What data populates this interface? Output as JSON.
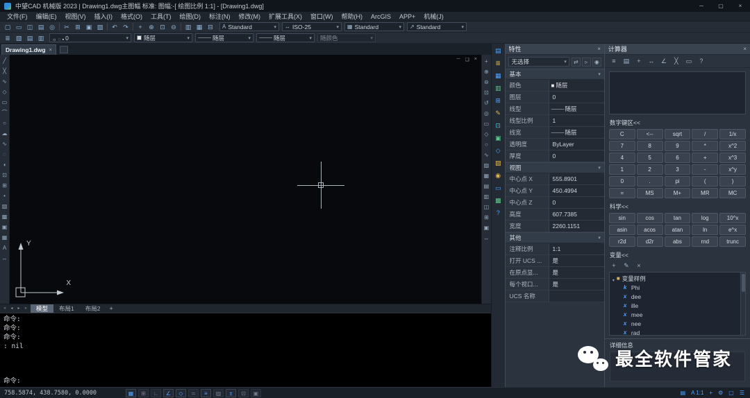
{
  "window": {
    "title": "中望CAD 机械版 2023 | Drawing1.dwg主图幅 标准: 图幅:-[ 绘图比例 1:1] - [Drawing1.dwg]",
    "minimize": "─",
    "maximize": "▢",
    "close": "×"
  },
  "menu": {
    "items": [
      "文件(F)",
      "编辑(E)",
      "视图(V)",
      "插入(I)",
      "格式(O)",
      "工具(T)",
      "绘图(D)",
      "标注(N)",
      "修改(M)",
      "扩展工具(X)",
      "窗口(W)",
      "帮助(H)",
      "ArcGIS",
      "APP+",
      "机械(J)"
    ]
  },
  "toolbar1": {
    "icons": [
      {
        "name": "new-file-icon",
        "glyph": "▢"
      },
      {
        "name": "open-file-icon",
        "glyph": "▭"
      },
      {
        "name": "save-icon",
        "glyph": "◫"
      },
      {
        "name": "plot-icon",
        "glyph": "▤"
      },
      {
        "name": "preview-icon",
        "glyph": "◎"
      },
      {
        "name": "separator",
        "glyph": "",
        "cls": "sep"
      },
      {
        "name": "cut-icon",
        "glyph": "✂"
      },
      {
        "name": "copy-icon",
        "glyph": "⊞"
      },
      {
        "name": "paste-icon",
        "glyph": "▣"
      },
      {
        "name": "match-properties-icon",
        "glyph": "▨"
      },
      {
        "name": "separator",
        "glyph": "",
        "cls": "sep"
      },
      {
        "name": "undo-icon",
        "glyph": "↶"
      },
      {
        "name": "redo-icon",
        "glyph": "↷"
      },
      {
        "name": "separator",
        "glyph": "",
        "cls": "sep"
      },
      {
        "name": "pan-icon",
        "glyph": "+"
      },
      {
        "name": "zoom-realtime-icon",
        "glyph": "⊕"
      },
      {
        "name": "zoom-window-icon",
        "glyph": "⊡"
      },
      {
        "name": "zoom-previous-icon",
        "glyph": "⊖"
      },
      {
        "name": "separator",
        "glyph": "",
        "cls": "sep"
      },
      {
        "name": "properties-toggle-icon",
        "glyph": "▥"
      },
      {
        "name": "designcenter-toggle-icon",
        "glyph": "▦"
      },
      {
        "name": "quickcalc-toggle-icon",
        "glyph": "⊟"
      }
    ],
    "dropdowns": [
      {
        "name": "text-style-dropdown",
        "icon": "A",
        "value": "Standard"
      },
      {
        "name": "dim-style-dropdown",
        "icon": "↔",
        "value": "ISO-25"
      },
      {
        "name": "table-style-dropdown",
        "icon": "▦",
        "value": "Standard"
      },
      {
        "name": "mleader-style-dropdown",
        "icon": "↗",
        "value": "Standard"
      }
    ]
  },
  "toolbar2": {
    "icons": [
      {
        "name": "layer-properties-icon",
        "glyph": "≣"
      },
      {
        "name": "layer-states-icon",
        "glyph": "▧"
      },
      {
        "name": "layer-isolate-icon",
        "glyph": "▤"
      },
      {
        "name": "layer-previous-icon",
        "glyph": "▥"
      }
    ],
    "layer": {
      "state_icons": [
        "☼",
        "◌",
        "▪"
      ],
      "value": "0"
    },
    "color": {
      "value": "随层"
    },
    "linetype": {
      "prefix": "———",
      "value": "随层"
    },
    "lineweight": {
      "prefix": "———",
      "value": "随层"
    },
    "plotstyle": {
      "value": "随颜色"
    }
  },
  "doc_tab": {
    "label": "Drawing1.dwg",
    "close": "×"
  },
  "canvas_controls": {
    "min": "─",
    "restore": "❏",
    "close": "×"
  },
  "ucs": {
    "x": "X",
    "y": "Y"
  },
  "draw_tools": {
    "icons": [
      {
        "name": "line-tool-icon",
        "glyph": "╱"
      },
      {
        "name": "xline-tool-icon",
        "glyph": "╳"
      },
      {
        "name": "polyline-tool-icon",
        "glyph": "∿"
      },
      {
        "name": "polygon-tool-icon",
        "glyph": "◇"
      },
      {
        "name": "rectangle-tool-icon",
        "glyph": "▭"
      },
      {
        "name": "arc-tool-icon",
        "glyph": "⌒"
      },
      {
        "name": "circle-tool-icon",
        "glyph": "○"
      },
      {
        "name": "revcloud-tool-icon",
        "glyph": "☁"
      },
      {
        "name": "spline-tool-icon",
        "glyph": "∿"
      },
      {
        "name": "ellipse-tool-icon",
        "glyph": "◌"
      },
      {
        "name": "ellipse-arc-tool-icon",
        "glyph": "◖"
      },
      {
        "name": "insert-block-tool-icon",
        "glyph": "⊡"
      },
      {
        "name": "make-block-tool-icon",
        "glyph": "⊞"
      },
      {
        "name": "point-tool-icon",
        "glyph": "•"
      },
      {
        "name": "hatch-tool-icon",
        "glyph": "▨"
      },
      {
        "name": "gradient-tool-icon",
        "glyph": "▩"
      },
      {
        "name": "region-tool-icon",
        "glyph": "▣"
      },
      {
        "name": "table-tool-icon",
        "glyph": "▦"
      },
      {
        "name": "text-tool-icon",
        "glyph": "A"
      },
      {
        "name": "dimension-tool-icon",
        "glyph": "↔"
      }
    ]
  },
  "view_tools": {
    "icons": [
      {
        "name": "pan-tool-icon",
        "glyph": "+"
      },
      {
        "name": "zoom-in-tool-icon",
        "glyph": "⊕"
      },
      {
        "name": "zoom-out-tool-icon",
        "glyph": "⊖"
      },
      {
        "name": "zoom-window-tool-icon",
        "glyph": "⊡"
      },
      {
        "name": "zoom-previous-tool-icon",
        "glyph": "↺"
      },
      {
        "name": "zoom-extents-tool-icon",
        "glyph": "◎"
      },
      {
        "name": "named-views-tool-icon",
        "glyph": "▭"
      },
      {
        "name": "orbit-tool-icon",
        "glyph": "◇"
      },
      {
        "name": "circle-view-tool-icon",
        "glyph": "○"
      },
      {
        "name": "regen-tool-icon",
        "glyph": "∿"
      },
      {
        "name": "hatch-view-tool-icon",
        "glyph": "▨"
      },
      {
        "name": "grid-view-tool-icon",
        "glyph": "▦"
      },
      {
        "name": "layout-view-tool-icon",
        "glyph": "▤"
      },
      {
        "name": "sheet-view-tool-icon",
        "glyph": "▥"
      },
      {
        "name": "save-view-tool-icon",
        "glyph": "◫"
      },
      {
        "name": "block-view-tool-icon",
        "glyph": "⊞"
      },
      {
        "name": "region-view-tool-icon",
        "glyph": "▣"
      },
      {
        "name": "measure-tool-icon",
        "glyph": "↔"
      }
    ]
  },
  "panel_strip": {
    "icons": [
      {
        "name": "properties-panel-icon",
        "glyph": "▤",
        "cls": "c-blue"
      },
      {
        "name": "layers-panel-icon",
        "glyph": "≣",
        "cls": "c-yellow"
      },
      {
        "name": "designcenter-panel-icon",
        "glyph": "▦",
        "cls": "c-blue"
      },
      {
        "name": "toolpalette-panel-icon",
        "glyph": "▥",
        "cls": "c-green"
      },
      {
        "name": "calculator-panel-icon",
        "glyph": "⊞",
        "cls": "c-blue"
      },
      {
        "name": "markup-panel-icon",
        "glyph": "✎",
        "cls": "c-yellow"
      },
      {
        "name": "xref-panel-icon",
        "glyph": "⊡",
        "cls": "c-cyan"
      },
      {
        "name": "sheetset-panel-icon",
        "glyph": "▣",
        "cls": "c-green"
      },
      {
        "name": "visualstyle-panel-icon",
        "glyph": "◇",
        "cls": "c-blue"
      },
      {
        "name": "materials-panel-icon",
        "glyph": "▨",
        "cls": "c-yellow"
      },
      {
        "name": "lights-panel-icon",
        "glyph": "◉",
        "cls": "c-yellow"
      },
      {
        "name": "views-panel-icon",
        "glyph": "▭",
        "cls": "c-blue"
      },
      {
        "name": "render-panel-icon",
        "glyph": "▩",
        "cls": "c-green"
      },
      {
        "name": "help-panel-icon",
        "glyph": "?",
        "cls": "c-blue"
      }
    ]
  },
  "layout_tabs": {
    "nav": [
      "«",
      "◂",
      "▸",
      "»"
    ],
    "tabs": [
      {
        "label": "模型",
        "active": true
      },
      {
        "label": "布局1"
      },
      {
        "label": "布局2"
      }
    ],
    "add": "+"
  },
  "command": {
    "history": [
      "命令:",
      "命令:",
      "命令:",
      ": nil"
    ],
    "prompt": "命令:"
  },
  "properties": {
    "title": "特性",
    "close": "×",
    "selector": {
      "value": "无选择"
    },
    "selector_icons": [
      {
        "name": "toggle-pickadd-icon",
        "glyph": "⇄"
      },
      {
        "name": "select-objects-icon",
        "glyph": "▹"
      },
      {
        "name": "quick-select-icon",
        "glyph": "◉"
      }
    ],
    "groups": [
      {
        "name": "基本",
        "rows": [
          {
            "label": "颜色",
            "value": "随层",
            "pre": "■",
            "cls": "c-color"
          },
          {
            "label": "图层",
            "value": "0"
          },
          {
            "label": "线型",
            "value": "随层",
            "pre": "———"
          },
          {
            "label": "线型比例",
            "value": "1"
          },
          {
            "label": "线宽",
            "value": "随层",
            "pre": "———"
          },
          {
            "label": "透明度",
            "value": "ByLayer"
          },
          {
            "label": "厚度",
            "value": "0"
          }
        ]
      },
      {
        "name": "视图",
        "rows": [
          {
            "label": "中心点 X",
            "value": "555.8901"
          },
          {
            "label": "中心点 Y",
            "value": "450.4994"
          },
          {
            "label": "中心点 Z",
            "value": "0"
          },
          {
            "label": "高度",
            "value": "607.7385"
          },
          {
            "label": "宽度",
            "value": "2260.1151"
          }
        ]
      },
      {
        "name": "其他",
        "rows": [
          {
            "label": "注释比例",
            "value": "1:1"
          },
          {
            "label": "打开 UCS ...",
            "value": "是"
          },
          {
            "label": "在原点显...",
            "value": "是"
          },
          {
            "label": "每个视口...",
            "value": "是"
          },
          {
            "label": "UCS 名称",
            "value": ""
          }
        ]
      }
    ]
  },
  "calculator": {
    "title": "计算器",
    "close": "×",
    "toolbar": [
      {
        "name": "calc-more-icon",
        "glyph": "≡"
      },
      {
        "name": "calc-store-icon",
        "glyph": "▤"
      },
      {
        "name": "calc-get-coordinate-icon",
        "glyph": "+"
      },
      {
        "name": "calc-distance-icon",
        "glyph": "↔"
      },
      {
        "name": "calc-angle-icon",
        "glyph": "∠"
      },
      {
        "name": "calc-intersection-icon",
        "glyph": "╳"
      },
      {
        "name": "calc-clear-icon",
        "glyph": "▭"
      },
      {
        "name": "calc-help-icon",
        "glyph": "?"
      }
    ],
    "display": "",
    "numpad_label": "数字键区<<",
    "numpad_keys": [
      "C",
      "<--",
      "sqrt",
      "/",
      "1/x",
      "7",
      "8",
      "9",
      "*",
      "x^2",
      "4",
      "5",
      "6",
      "+",
      "x^3",
      "1",
      "2",
      "3",
      "-",
      "x^y",
      "0",
      ".",
      "pi",
      "(",
      ")",
      "=",
      "MS",
      "M+",
      "MR",
      "MC"
    ],
    "sci_label": "科学<<",
    "sci_keys": [
      "sin",
      "cos",
      "tan",
      "log",
      "10^x",
      "asin",
      "acos",
      "atan",
      "ln",
      "e^x",
      "r2d",
      "d2r",
      "abs",
      "rnd",
      "trunc"
    ],
    "vars_label": "变量<<",
    "vars_toolbar": [
      {
        "name": "new-variable-icon",
        "glyph": "+"
      },
      {
        "name": "edit-variable-icon",
        "glyph": "✎"
      },
      {
        "name": "delete-variable-icon",
        "glyph": "×"
      }
    ],
    "tree_root_icon": "■",
    "tree_root": "变量样例",
    "variables": [
      {
        "icon": "k",
        "label": "Phi"
      },
      {
        "icon": "x",
        "label": "dee"
      },
      {
        "icon": "x",
        "label": "ille"
      },
      {
        "icon": "x",
        "label": "mee"
      },
      {
        "icon": "x",
        "label": "nee"
      },
      {
        "icon": "x",
        "label": "rad"
      }
    ],
    "details_label": "详细信息"
  },
  "status": {
    "coords": "758.5874, 438.7580, 0.0000",
    "toggles": [
      {
        "name": "grid-toggle",
        "glyph": "▦",
        "active": true
      },
      {
        "name": "snap-toggle",
        "glyph": "⊞"
      },
      {
        "name": "ortho-toggle",
        "glyph": "∟"
      },
      {
        "name": "polar-toggle",
        "glyph": "∠",
        "active": true
      },
      {
        "name": "esnap-toggle",
        "glyph": "◇",
        "active": true
      },
      {
        "name": "etrack-toggle",
        "glyph": "≍"
      },
      {
        "name": "lineweight-toggle",
        "glyph": "≡",
        "active": true
      },
      {
        "name": "transparency-toggle",
        "glyph": "▨"
      },
      {
        "name": "dyn-toggle",
        "glyph": "±",
        "active": true
      },
      {
        "name": "cycle-toggle",
        "glyph": "⊡"
      },
      {
        "name": "dynucs-toggle",
        "glyph": "▣"
      }
    ],
    "right_icons": [
      {
        "name": "model-space-icon",
        "glyph": "▤"
      },
      {
        "name": "annotation-scale",
        "glyph": "A 1:1"
      },
      {
        "name": "annotation-visibility-icon",
        "glyph": "+"
      },
      {
        "name": "workspace-gear-icon",
        "glyph": "⚙"
      },
      {
        "name": "clean-screen-icon",
        "glyph": "▢"
      },
      {
        "name": "menu-burger-icon",
        "glyph": "☰"
      }
    ]
  },
  "watermark": {
    "text": "最全软件管家"
  }
}
